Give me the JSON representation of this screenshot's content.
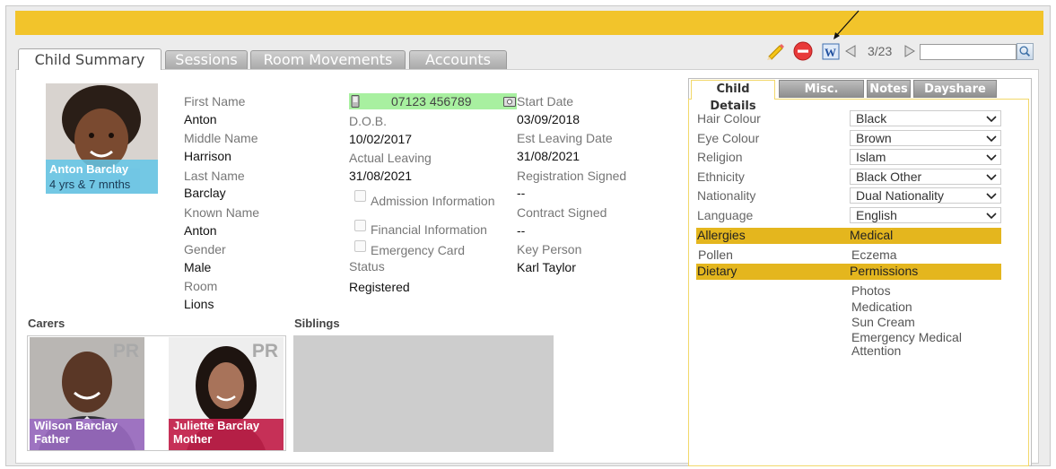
{
  "tabs": [
    "Child Summary",
    "Sessions",
    "Room Movements",
    "Accounts"
  ],
  "toolbar": {
    "edit_icon": "pencil-icon",
    "delete_icon": "no-entry-icon",
    "word_icon": "word-doc-icon",
    "record_counter": "3/23",
    "search_placeholder": ""
  },
  "child": {
    "photo_name": "Anton Barclay",
    "photo_age": "4 yrs & 7 mnths",
    "phone": "07123 456789",
    "col1": [
      {
        "label": "First Name",
        "value": "Anton"
      },
      {
        "label": "Middle Name",
        "value": "Harrison"
      },
      {
        "label": "Last Name",
        "value": "Barclay"
      },
      {
        "label": "Known Name",
        "value": "Anton"
      },
      {
        "label": "Gender",
        "value": "Male"
      },
      {
        "label": "Room",
        "value": "Lions"
      }
    ],
    "col2": [
      {
        "label": "D.O.B.",
        "value": "10/02/2017"
      },
      {
        "label": "Actual Leaving",
        "value": "31/08/2021"
      }
    ],
    "checkboxes": [
      "Admission Information",
      "Financial Information",
      "Emergency Card"
    ],
    "status": {
      "label": "Status",
      "value": "Registered"
    },
    "col3": [
      {
        "label": "Start Date",
        "value": "03/09/2018"
      },
      {
        "label": "Est Leaving Date",
        "value": "31/08/2021"
      },
      {
        "label": "Registration Signed",
        "value": "--"
      },
      {
        "label": "Contract Signed",
        "value": "--"
      },
      {
        "label": "Key Person",
        "value": "Karl Taylor"
      }
    ]
  },
  "carers_title": "Carers",
  "siblings_title": "Siblings",
  "carers": [
    {
      "badge": "PR",
      "name": "Wilson Barclay",
      "relation": "Father",
      "color": "#9b6cc2"
    },
    {
      "badge": "PR",
      "name": "Juliette Barclay",
      "relation": "Mother",
      "color": "#c2204a"
    }
  ],
  "right_tabs": [
    "Child Details",
    "Misc. Details",
    "Notes",
    "Dayshare"
  ],
  "details": [
    {
      "label": "Hair Colour",
      "value": "Black"
    },
    {
      "label": "Eye Colour",
      "value": "Brown"
    },
    {
      "label": "Religion",
      "value": "Islam"
    },
    {
      "label": "Ethnicity",
      "value": "Black Other"
    },
    {
      "label": "Nationality",
      "value": "Dual Nationality"
    },
    {
      "label": "Language",
      "value": "English"
    }
  ],
  "allergies": {
    "left": "Allergies",
    "right": "Medical",
    "left_items": [
      "Pollen"
    ],
    "right_items": [
      "Eczema"
    ]
  },
  "dietary": {
    "left": "Dietary",
    "right": "Permissions",
    "right_items": [
      "Photos",
      "Medication",
      "Sun Cream",
      "Emergency Medical Attention"
    ]
  },
  "colors": {
    "accent_yellow": "#f2c42b",
    "section_yellow": "#e4b61e",
    "phone_green": "#a8f0a0",
    "photo_caption": "#61c5e8"
  }
}
